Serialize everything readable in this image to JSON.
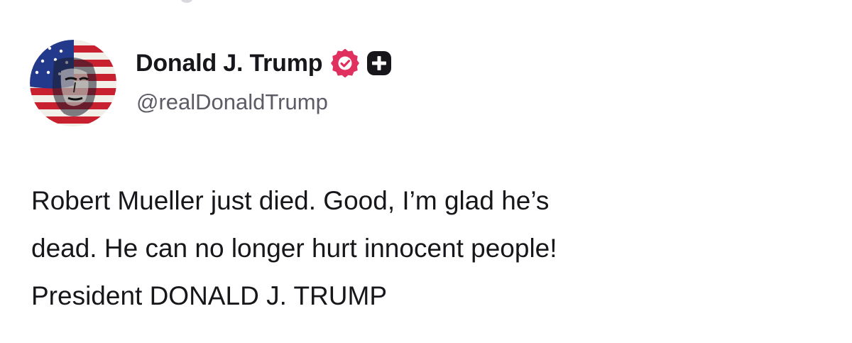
{
  "post": {
    "author": {
      "display_name": "Donald J. Trump",
      "handle": "@realDonaldTrump",
      "avatar_icon": "flag-portrait-avatar",
      "verified_icon": "verified-badge-icon",
      "verified_color": "#e0305f",
      "subscription_icon": "plus-badge-icon"
    },
    "text_lines": [
      "Robert Mueller just died. Good, I’m glad he’s",
      "dead. He can no longer hurt innocent people!",
      "President DONALD J. TRUMP"
    ]
  }
}
